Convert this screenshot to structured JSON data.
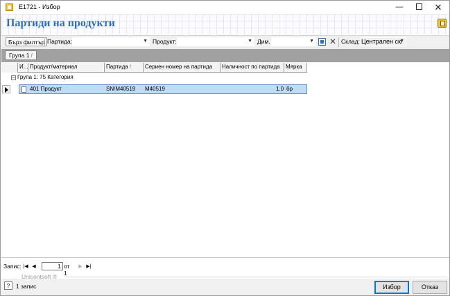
{
  "window": {
    "title": "E1721 - Избор"
  },
  "header": {
    "title": "Партиди на продукти"
  },
  "filterbar": {
    "quick_filter_label": "Бърз филтър",
    "batch_label": "Партида:",
    "batch_value": "",
    "product_label": "Продукт:",
    "product_value": "",
    "dim_label": "Дим.",
    "dim_value": "",
    "warehouse_label": "Склад:",
    "warehouse_value": "Централен ск/"
  },
  "group_panel": {
    "chip_label": "Група 1",
    "chip_sort": "/"
  },
  "grid": {
    "columns": [
      {
        "label": "И..."
      },
      {
        "label": "Продукт/материал"
      },
      {
        "label": "Партида",
        "sort": "/"
      },
      {
        "label": "Сериен номер на партида"
      },
      {
        "label": "Наличност по партида"
      },
      {
        "label": "Мярка"
      }
    ],
    "group_row": {
      "expander": "–",
      "text": "Група 1: 75 Категория"
    },
    "rows": [
      {
        "product": "401 Продукт",
        "batch": "SN/M40519",
        "serial": "M40519",
        "qty": "1.0",
        "unit": "бр"
      }
    ]
  },
  "navigator": {
    "label": "Запис:",
    "current": "1",
    "of_text": "от 1"
  },
  "brand": "Unicontsoft ®",
  "status": {
    "record_count": "1 запис"
  },
  "buttons": {
    "ok": "Избор",
    "cancel": "Отказ"
  },
  "colors": {
    "title_blue": "#2d6dc4",
    "selection": "#c0dcf3",
    "group_panel": "#a0a0a0"
  }
}
